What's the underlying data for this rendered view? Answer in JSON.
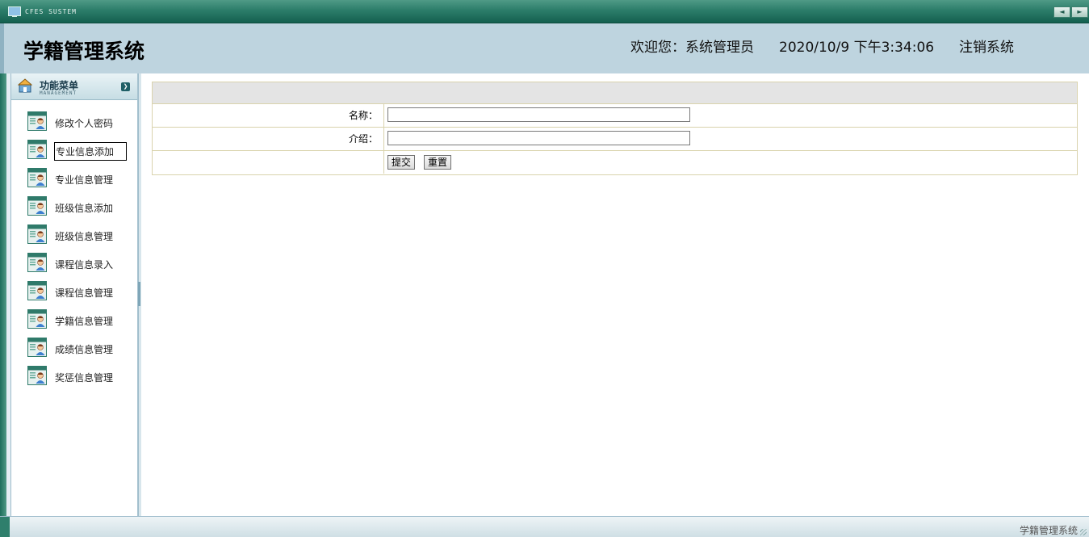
{
  "window": {
    "title": "CFES SUSTEM",
    "nav_prev": "◄",
    "nav_next": "►"
  },
  "header": {
    "app_title": "学籍管理系统",
    "welcome": "欢迎您：系统管理员",
    "datetime": "2020/10/9 下午3:34:06",
    "logout": "注销系统"
  },
  "sidebar": {
    "menu_title": "功能菜单",
    "menu_subtitle": "MANAGEMENT",
    "items": [
      {
        "label": "修改个人密码",
        "icon": "user-card-icon"
      },
      {
        "label": "专业信息添加",
        "icon": "user-card-icon",
        "selected": true
      },
      {
        "label": "专业信息管理",
        "icon": "user-card-icon"
      },
      {
        "label": "班级信息添加",
        "icon": "user-card-icon"
      },
      {
        "label": "班级信息管理",
        "icon": "user-card-icon"
      },
      {
        "label": "课程信息录入",
        "icon": "user-card-icon"
      },
      {
        "label": "课程信息管理",
        "icon": "user-card-icon"
      },
      {
        "label": "学籍信息管理",
        "icon": "user-card-icon"
      },
      {
        "label": "成绩信息管理",
        "icon": "user-card-icon"
      },
      {
        "label": "奖惩信息管理",
        "icon": "user-card-icon"
      }
    ]
  },
  "form": {
    "name_label": "名称：",
    "name_value": "",
    "intro_label": "介绍：",
    "intro_value": "",
    "submit_label": "提交",
    "reset_label": "重置"
  },
  "footer": {
    "text": "学籍管理系统"
  },
  "colors": {
    "titlebar": "#2c7d6a",
    "header": "#bed4df",
    "form_border": "#d9d3ad"
  }
}
